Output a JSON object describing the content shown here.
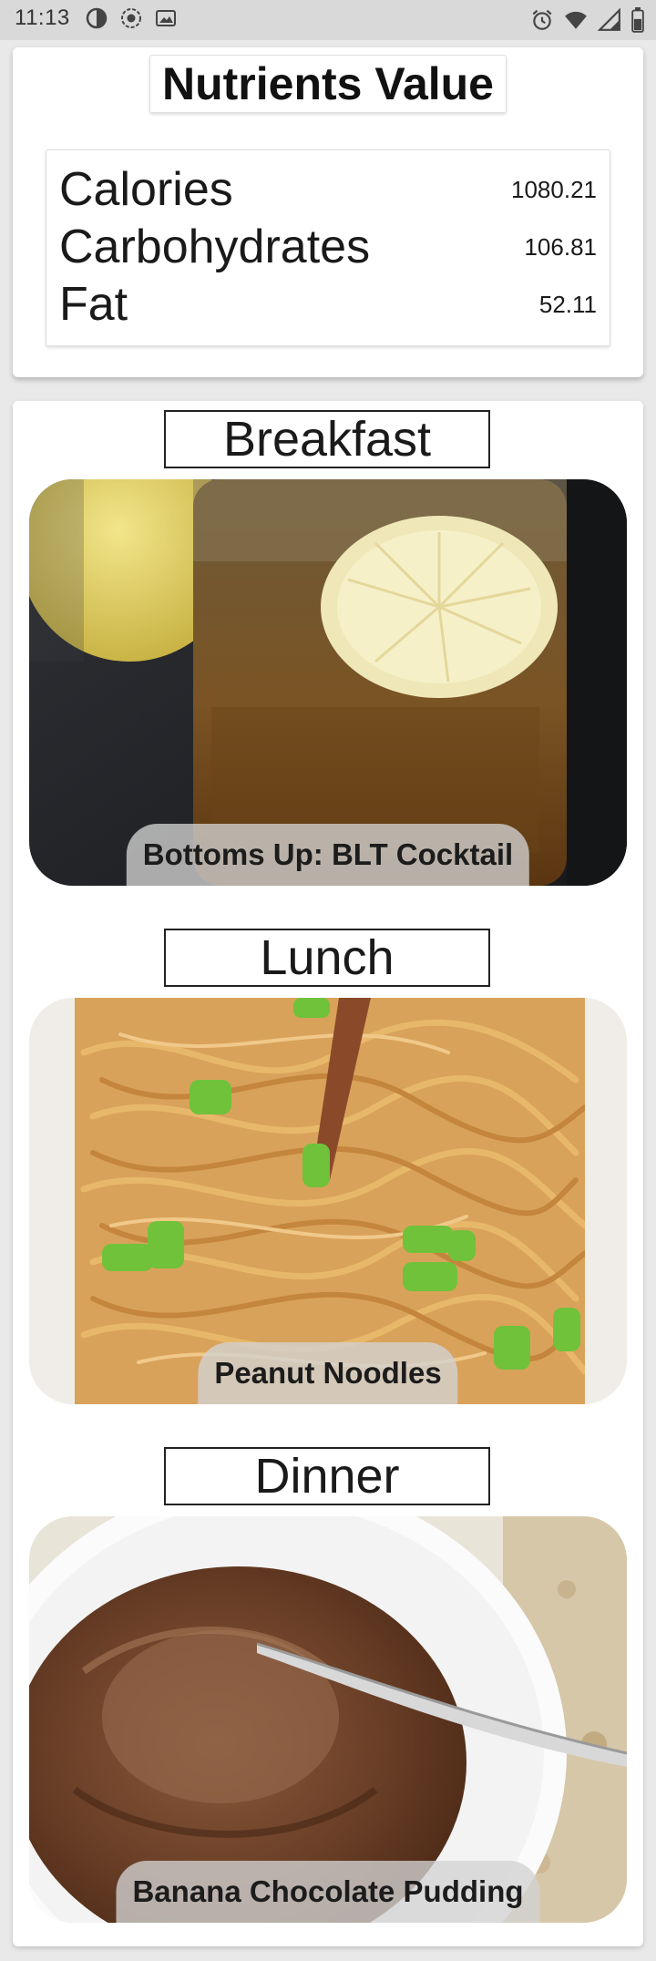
{
  "status_bar": {
    "time": "11:13",
    "left_icons": [
      "data-saver-icon",
      "screen-record-icon",
      "image-icon"
    ],
    "right_icons": [
      "alarm-icon",
      "wifi-icon",
      "signal-icon",
      "battery-icon"
    ]
  },
  "nutrients": {
    "title": "Nutrients Value",
    "rows": [
      {
        "label": "Calories",
        "value": "1080.21"
      },
      {
        "label": "Carbohydrates",
        "value": "106.81"
      },
      {
        "label": "Fat",
        "value": "52.11"
      }
    ]
  },
  "meals": [
    {
      "title": "Breakfast",
      "dish": "Bottoms Up: BLT Cocktail",
      "image": "iced-tea-lemon-jar-photo"
    },
    {
      "title": "Lunch",
      "dish": "Peanut Noodles",
      "image": "peanut-noodles-photo"
    },
    {
      "title": "Dinner",
      "dish": "Banana Chocolate Pudding",
      "image": "chocolate-pudding-bowl-photo"
    }
  ],
  "colors": {
    "background": "#e9e9e9",
    "card": "#ffffff",
    "status_bar": "#d9d9d9",
    "pill": "#d2d2d2"
  }
}
